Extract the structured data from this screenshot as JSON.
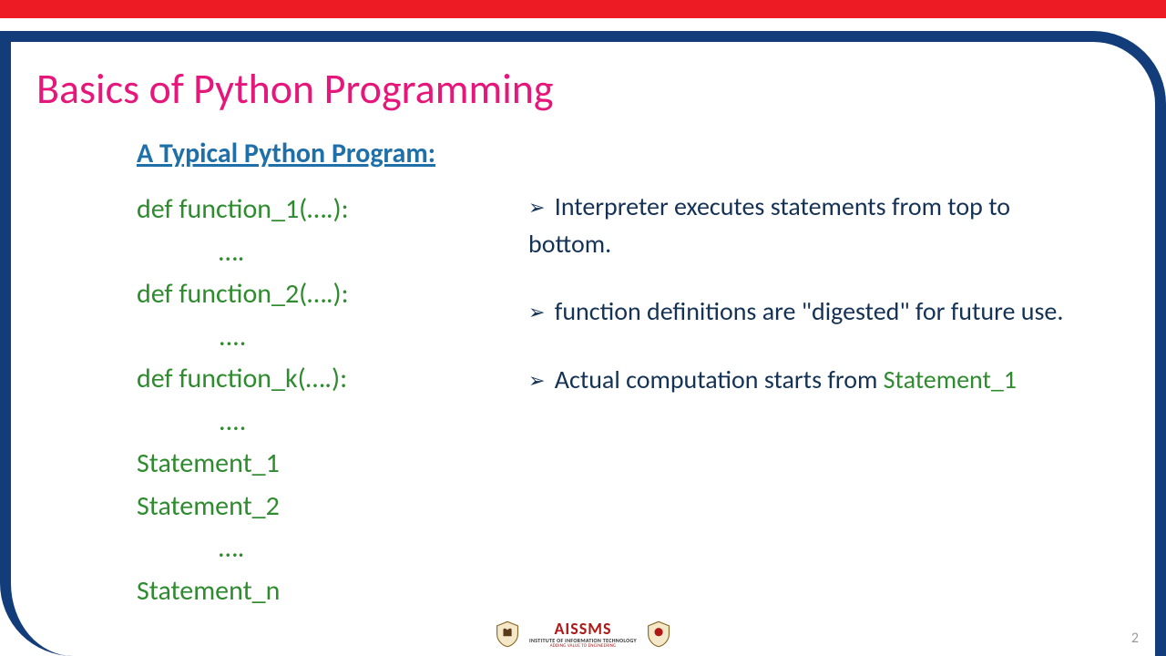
{
  "colors": {
    "red_bar": "#ed1c24",
    "blue_border": "#133d7a",
    "title_pink": "#e5177b",
    "subtitle_blue": "#1f6fa8",
    "code_green": "#2e8b2e",
    "body_navy": "#143256"
  },
  "title": "Basics of Python Programming",
  "subtitle": "A Typical Python Program:",
  "code_lines": {
    "l1": "def function_1(….):",
    "l2": "….",
    "l3": "def function_2(….):",
    "l4": "....",
    "l5": "def function_k(….):",
    "l6": "....",
    "l7": "Statement_1",
    "l8": "Statement_2",
    "l9": "….",
    "l10": "Statement_n"
  },
  "bullets": {
    "b1": "Interpreter executes statements from top to bottom.",
    "b2": "function definitions are \"digested\" for future use.",
    "b3_pre": "Actual computation starts from ",
    "b3_stmt": "Statement_1"
  },
  "logo": {
    "main": "AISSMS",
    "sub": "INSTITUTE OF INFORMATION TECHNOLOGY",
    "tag": "ADDING VALUE TO ENGINEERING"
  },
  "page_number": "2"
}
